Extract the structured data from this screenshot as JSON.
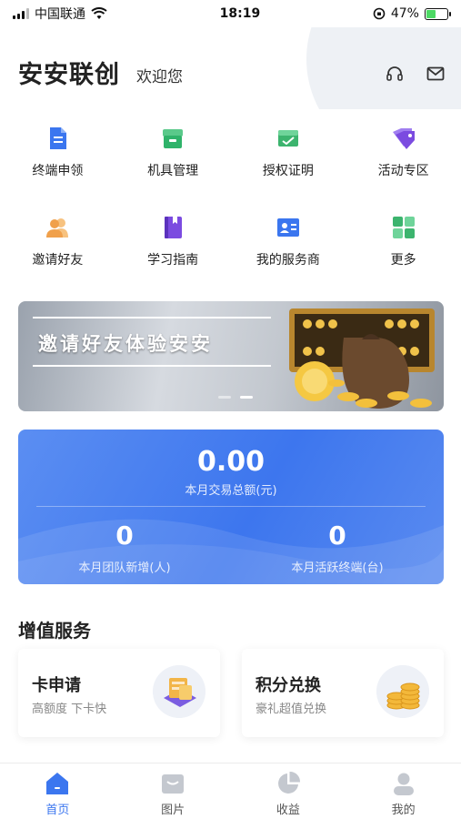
{
  "status_bar": {
    "carrier": "中国联通",
    "time": "18:19",
    "battery_percent": "47%",
    "icons": [
      "signal-icon",
      "wifi-icon",
      "orientation-lock-icon",
      "battery-icon"
    ]
  },
  "header": {
    "brand": "安安联创",
    "welcome": "欢迎您",
    "icons": [
      "headset-icon",
      "mail-icon"
    ]
  },
  "quick_menu": [
    {
      "label": "终端申领",
      "icon": "document-icon",
      "color": "#3b76ef"
    },
    {
      "label": "机具管理",
      "icon": "archive-box-icon",
      "color": "#2fb36a"
    },
    {
      "label": "授权证明",
      "icon": "certificate-icon",
      "color": "#3cb46e"
    },
    {
      "label": "活动专区",
      "icon": "tag-icon",
      "color": "#7b4be0"
    },
    {
      "label": "邀请好友",
      "icon": "users-icon",
      "color": "#f0a04b"
    },
    {
      "label": "学习指南",
      "icon": "book-icon",
      "color": "#7b4be0"
    },
    {
      "label": "我的服务商",
      "icon": "id-card-icon",
      "color": "#3b76ef"
    },
    {
      "label": "更多",
      "icon": "grid-icon",
      "color": "#3cb46e"
    }
  ],
  "banner": {
    "title": "邀请好友体验安安",
    "slide_count": 2,
    "active_slide": 2
  },
  "stats": {
    "total": "0.00",
    "total_label": "本月交易总额(元)",
    "team_new": "0",
    "team_new_label": "本月团队新增(人)",
    "active_terminals": "0",
    "active_terminals_label": "本月活跃终端(台)"
  },
  "value_added": {
    "title": "增值服务",
    "cards": [
      {
        "title": "卡申请",
        "subtitle": "高额度 下卡快",
        "icon": "credit-card-icon"
      },
      {
        "title": "积分兑换",
        "subtitle": "豪礼超值兑换",
        "icon": "gold-coins-icon"
      }
    ]
  },
  "tabbar": {
    "active": "首页",
    "items": [
      {
        "label": "首页",
        "icon": "home-icon"
      },
      {
        "label": "图片",
        "icon": "inbox-icon"
      },
      {
        "label": "收益",
        "icon": "pie-chart-icon"
      },
      {
        "label": "我的",
        "icon": "user-icon"
      }
    ]
  },
  "colors": {
    "accent": "#3b76ef",
    "tab_inactive": "#c4c8cf"
  }
}
